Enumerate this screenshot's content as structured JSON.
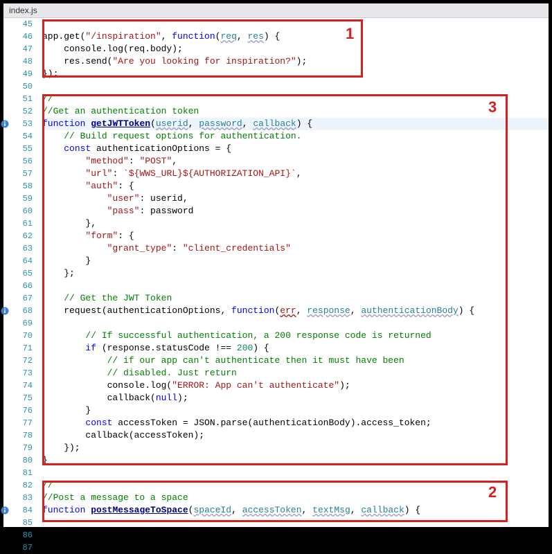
{
  "tab": {
    "filename": "index.js"
  },
  "annotations": {
    "box1_label": "1",
    "box2_label": "2",
    "box3_label": "3"
  },
  "info_marker_lines": [
    53,
    68,
    84
  ],
  "lines": [
    {
      "num": 45,
      "tokens": []
    },
    {
      "num": 46,
      "tokens": [
        {
          "t": "app.get(",
          "c": "ident"
        },
        {
          "t": "\"/inspiration\"",
          "c": "str"
        },
        {
          "t": ", ",
          "c": "punc"
        },
        {
          "t": "function",
          "c": "kw"
        },
        {
          "t": "(",
          "c": "punc"
        },
        {
          "t": "req",
          "c": "param"
        },
        {
          "t": ", ",
          "c": "punc"
        },
        {
          "t": "res",
          "c": "param"
        },
        {
          "t": ") {",
          "c": "punc"
        }
      ]
    },
    {
      "num": 47,
      "tokens": [
        {
          "t": "    console.log(req.body);",
          "c": "ident"
        }
      ]
    },
    {
      "num": 48,
      "tokens": [
        {
          "t": "    res.send(",
          "c": "ident"
        },
        {
          "t": "\"Are you looking for inspiration?\"",
          "c": "str"
        },
        {
          "t": ");",
          "c": "punc"
        }
      ]
    },
    {
      "num": 49,
      "tokens": [
        {
          "t": "});",
          "c": "punc"
        }
      ]
    },
    {
      "num": 50,
      "tokens": []
    },
    {
      "num": 51,
      "tokens": [
        {
          "t": "//",
          "c": "com"
        }
      ]
    },
    {
      "num": 52,
      "tokens": [
        {
          "t": "//Get an authentication token",
          "c": "com"
        }
      ]
    },
    {
      "num": 53,
      "highlight": true,
      "tokens": [
        {
          "t": "function",
          "c": "kw"
        },
        {
          "t": " ",
          "c": "punc"
        },
        {
          "t": "getJWTToken",
          "c": "fn-def"
        },
        {
          "t": "(",
          "c": "punc"
        },
        {
          "t": "userid",
          "c": "param"
        },
        {
          "t": ", ",
          "c": "punc"
        },
        {
          "t": "password",
          "c": "param"
        },
        {
          "t": ", ",
          "c": "punc"
        },
        {
          "t": "callback",
          "c": "param"
        },
        {
          "t": ") ",
          "c": "punc"
        },
        {
          "t": "{",
          "c": "punc"
        }
      ]
    },
    {
      "num": 54,
      "tokens": [
        {
          "t": "    ",
          "c": "punc"
        },
        {
          "t": "// Build request options for authentication.",
          "c": "com"
        }
      ]
    },
    {
      "num": 55,
      "tokens": [
        {
          "t": "    ",
          "c": "punc"
        },
        {
          "t": "const",
          "c": "kw"
        },
        {
          "t": " authenticationOptions = {",
          "c": "ident"
        }
      ]
    },
    {
      "num": 56,
      "tokens": [
        {
          "t": "        ",
          "c": "punc"
        },
        {
          "t": "\"method\"",
          "c": "prop"
        },
        {
          "t": ": ",
          "c": "punc"
        },
        {
          "t": "\"POST\"",
          "c": "str"
        },
        {
          "t": ",",
          "c": "punc"
        }
      ]
    },
    {
      "num": 57,
      "tokens": [
        {
          "t": "        ",
          "c": "punc"
        },
        {
          "t": "\"url\"",
          "c": "prop"
        },
        {
          "t": ": ",
          "c": "punc"
        },
        {
          "t": "`${WWS_URL}${AUTHORIZATION_API}`",
          "c": "str"
        },
        {
          "t": ",",
          "c": "punc"
        }
      ]
    },
    {
      "num": 58,
      "tokens": [
        {
          "t": "        ",
          "c": "punc"
        },
        {
          "t": "\"auth\"",
          "c": "prop"
        },
        {
          "t": ": {",
          "c": "punc"
        }
      ]
    },
    {
      "num": 59,
      "tokens": [
        {
          "t": "            ",
          "c": "punc"
        },
        {
          "t": "\"user\"",
          "c": "prop"
        },
        {
          "t": ": userid,",
          "c": "ident"
        }
      ]
    },
    {
      "num": 60,
      "tokens": [
        {
          "t": "            ",
          "c": "punc"
        },
        {
          "t": "\"pass\"",
          "c": "prop"
        },
        {
          "t": ": password",
          "c": "ident"
        }
      ]
    },
    {
      "num": 61,
      "tokens": [
        {
          "t": "        },",
          "c": "punc"
        }
      ]
    },
    {
      "num": 62,
      "tokens": [
        {
          "t": "        ",
          "c": "punc"
        },
        {
          "t": "\"form\"",
          "c": "prop"
        },
        {
          "t": ": {",
          "c": "punc"
        }
      ]
    },
    {
      "num": 63,
      "tokens": [
        {
          "t": "            ",
          "c": "punc"
        },
        {
          "t": "\"grant_type\"",
          "c": "prop"
        },
        {
          "t": ": ",
          "c": "punc"
        },
        {
          "t": "\"client_credentials\"",
          "c": "str"
        }
      ]
    },
    {
      "num": 64,
      "tokens": [
        {
          "t": "        }",
          "c": "punc"
        }
      ]
    },
    {
      "num": 65,
      "tokens": [
        {
          "t": "    };",
          "c": "punc"
        }
      ]
    },
    {
      "num": 66,
      "tokens": []
    },
    {
      "num": 67,
      "tokens": [
        {
          "t": "    ",
          "c": "punc"
        },
        {
          "t": "// Get the JWT Token",
          "c": "com"
        }
      ]
    },
    {
      "num": 68,
      "tokens": [
        {
          "t": "    request(authenticationOptions, ",
          "c": "ident"
        },
        {
          "t": "function",
          "c": "kw"
        },
        {
          "t": "(",
          "c": "punc"
        },
        {
          "t": "err",
          "c": "param-err"
        },
        {
          "t": ", ",
          "c": "punc"
        },
        {
          "t": "response",
          "c": "param"
        },
        {
          "t": ", ",
          "c": "punc"
        },
        {
          "t": "authenticationBody",
          "c": "param"
        },
        {
          "t": ") {",
          "c": "punc"
        }
      ]
    },
    {
      "num": 69,
      "tokens": []
    },
    {
      "num": 70,
      "tokens": [
        {
          "t": "        ",
          "c": "punc"
        },
        {
          "t": "// If successful authentication, a 200 response code is returned",
          "c": "com"
        }
      ]
    },
    {
      "num": 71,
      "tokens": [
        {
          "t": "        ",
          "c": "punc"
        },
        {
          "t": "if",
          "c": "kw"
        },
        {
          "t": " (response.statusCode ",
          "c": "ident"
        },
        {
          "t": "!==",
          "c": "punc"
        },
        {
          "t": " ",
          "c": "punc"
        },
        {
          "t": "200",
          "c": "num"
        },
        {
          "t": ") {",
          "c": "punc"
        }
      ]
    },
    {
      "num": 72,
      "tokens": [
        {
          "t": "            ",
          "c": "punc"
        },
        {
          "t": "// if our app can't authenticate then it must have been",
          "c": "com"
        }
      ]
    },
    {
      "num": 73,
      "tokens": [
        {
          "t": "            ",
          "c": "punc"
        },
        {
          "t": "// disabled. Just return",
          "c": "com"
        }
      ]
    },
    {
      "num": 74,
      "tokens": [
        {
          "t": "            console.log(",
          "c": "ident"
        },
        {
          "t": "\"ERROR: App can't authenticate\"",
          "c": "str"
        },
        {
          "t": ");",
          "c": "punc"
        }
      ]
    },
    {
      "num": 75,
      "tokens": [
        {
          "t": "            callback(",
          "c": "ident"
        },
        {
          "t": "null",
          "c": "kw"
        },
        {
          "t": ");",
          "c": "punc"
        }
      ]
    },
    {
      "num": 76,
      "tokens": [
        {
          "t": "        }",
          "c": "punc"
        }
      ]
    },
    {
      "num": 77,
      "tokens": [
        {
          "t": "        ",
          "c": "punc"
        },
        {
          "t": "const",
          "c": "kw"
        },
        {
          "t": " accessToken = JSON.parse(authenticationBody).access_token;",
          "c": "ident"
        }
      ]
    },
    {
      "num": 78,
      "tokens": [
        {
          "t": "        callback(accessToken);",
          "c": "ident"
        }
      ]
    },
    {
      "num": 79,
      "tokens": [
        {
          "t": "    });",
          "c": "punc"
        }
      ]
    },
    {
      "num": 80,
      "tokens": [
        {
          "t": "}",
          "c": "punc"
        }
      ]
    },
    {
      "num": 81,
      "tokens": []
    },
    {
      "num": 82,
      "tokens": [
        {
          "t": "//",
          "c": "com"
        }
      ]
    },
    {
      "num": 83,
      "tokens": [
        {
          "t": "//Post a message to a space",
          "c": "com"
        }
      ]
    },
    {
      "num": 84,
      "tokens": [
        {
          "t": "function",
          "c": "kw"
        },
        {
          "t": " ",
          "c": "punc"
        },
        {
          "t": "postMessageToSpace",
          "c": "fn-def"
        },
        {
          "t": "(",
          "c": "punc"
        },
        {
          "t": "spaceId",
          "c": "param"
        },
        {
          "t": ", ",
          "c": "punc"
        },
        {
          "t": "accessToken",
          "c": "param"
        },
        {
          "t": ", ",
          "c": "punc"
        },
        {
          "t": "textMsg",
          "c": "param"
        },
        {
          "t": ", ",
          "c": "punc"
        },
        {
          "t": "callback",
          "c": "param"
        },
        {
          "t": ") {",
          "c": "punc"
        }
      ]
    },
    {
      "num": 85,
      "tokens": []
    },
    {
      "num": 86,
      "tokens": []
    },
    {
      "num": 87,
      "tokens": [
        {
          "t": "}",
          "c": "punc"
        }
      ]
    }
  ]
}
